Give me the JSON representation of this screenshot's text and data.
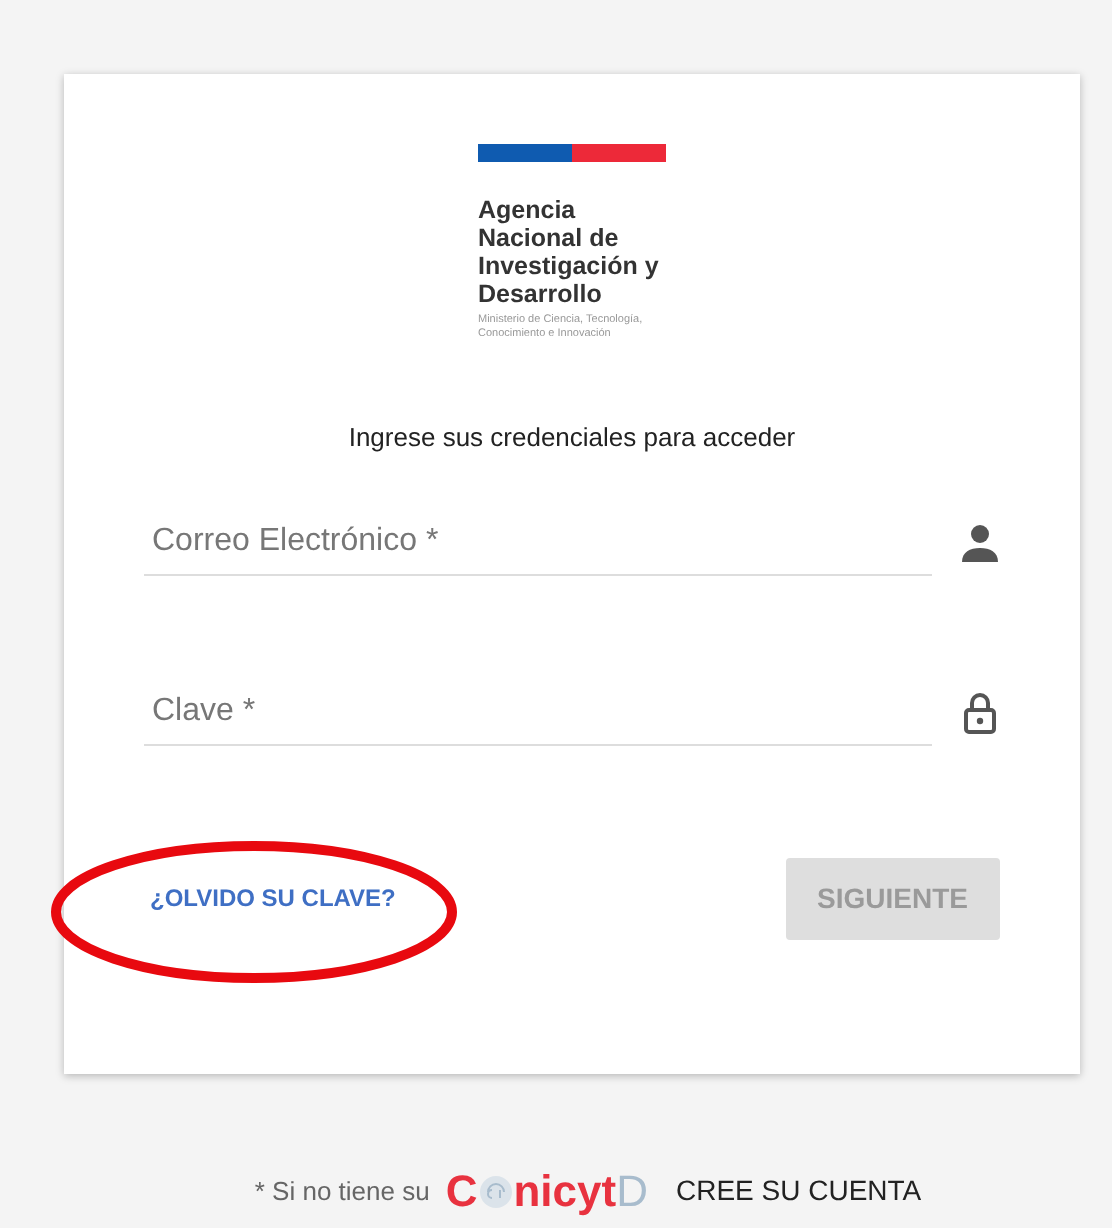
{
  "logo": {
    "title": "Agencia Nacional de Investigación y Desarrollo",
    "subtitle": "Ministerio de Ciencia, Tecnología, Conocimiento e Innovación"
  },
  "prompt": "Ingrese sus credenciales para acceder",
  "fields": [
    {
      "placeholder": "Correo Electrónico *",
      "kind": "user"
    },
    {
      "placeholder": "Clave *",
      "kind": "lock"
    }
  ],
  "forgot_link": "¿OLVIDO SU CLAVE?",
  "next_button": {
    "label": "SIGUIENTE",
    "disabled": true
  },
  "footer": {
    "note": "* Si no tiene su",
    "brand_start": "C",
    "brand_middle": "nicyt",
    "brand_end": "D",
    "signup_link": "CREE SU CUENTA"
  }
}
